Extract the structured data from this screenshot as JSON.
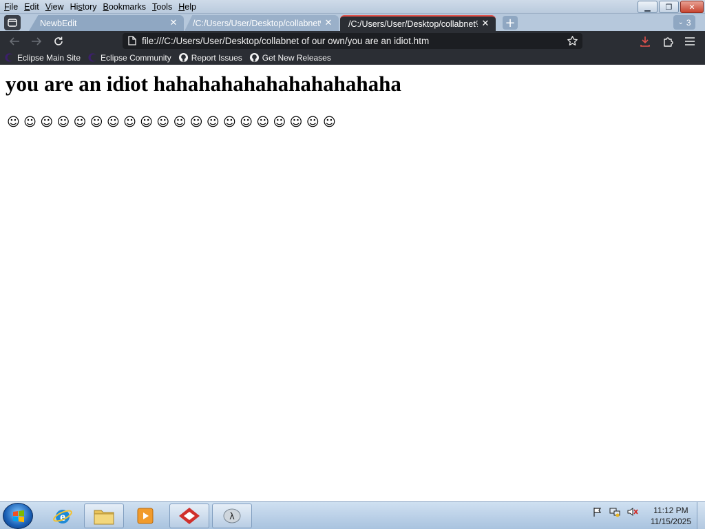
{
  "menubar": {
    "items": [
      {
        "accel": "F",
        "rest": "ile"
      },
      {
        "accel": "E",
        "rest": "dit"
      },
      {
        "accel": "V",
        "rest": "iew"
      },
      {
        "pre": "Hi",
        "accel": "s",
        "rest": "tory"
      },
      {
        "accel": "B",
        "rest": "ookmarks"
      },
      {
        "accel": "T",
        "rest": "ools"
      },
      {
        "accel": "H",
        "rest": "elp"
      }
    ]
  },
  "tabs": [
    {
      "title": "NewbEdit"
    },
    {
      "title": "/C:/Users/User/Desktop/collabnet%"
    },
    {
      "title": "/C:/Users/User/Desktop/collabnet%"
    }
  ],
  "tab_count": "3",
  "url": "file:///C:/Users/User/Desktop/collabnet of our own/you are an idiot.htm",
  "bookmarks": [
    {
      "label": "Eclipse Main Site",
      "icon": "eclipse-icon"
    },
    {
      "label": "Eclipse Community",
      "icon": "eclipse-icon"
    },
    {
      "label": "Report Issues",
      "icon": "github-icon"
    },
    {
      "label": "Get New Releases",
      "icon": "github-icon"
    }
  ],
  "page": {
    "heading": "you are an idiot hahahahahahahahahahaha",
    "smiley": "☺",
    "smiley_count": 20
  },
  "taskbar": {
    "time": "11:12 PM",
    "date": "11/15/2025"
  },
  "colors": {
    "active_tab_accent": "#e2524c",
    "toolbar_bg": "#2b2e34",
    "download_icon": "#e2524c"
  }
}
